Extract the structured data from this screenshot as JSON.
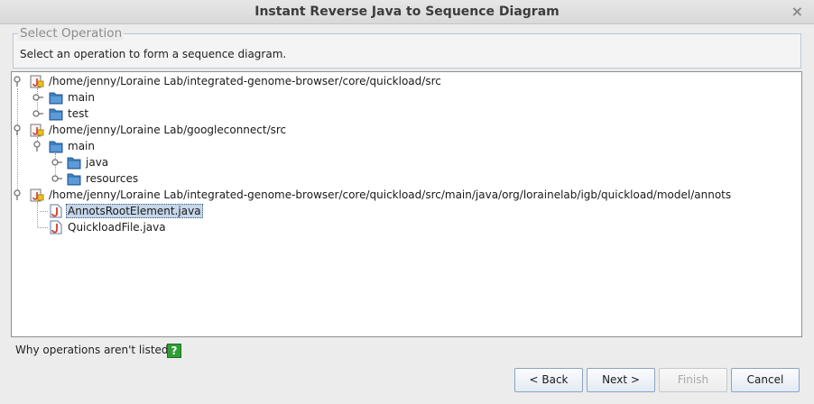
{
  "window": {
    "title": "Instant Reverse Java to Sequence Diagram",
    "close_glyph": "×"
  },
  "section": {
    "legend": "Select Operation",
    "description": "Select an operation to form a sequence diagram."
  },
  "tree": {
    "nodes": [
      {
        "label": "/home/jenny/Loraine Lab/integrated-genome-browser/core/quickload/src",
        "icon": "java-package-root-icon"
      },
      {
        "label": "main",
        "icon": "folder-icon"
      },
      {
        "label": "test",
        "icon": "folder-icon"
      },
      {
        "label": "/home/jenny/Loraine Lab/googleconnect/src",
        "icon": "java-package-root-icon"
      },
      {
        "label": "main",
        "icon": "folder-icon"
      },
      {
        "label": "java",
        "icon": "folder-icon"
      },
      {
        "label": "resources",
        "icon": "folder-icon"
      },
      {
        "label": "/home/jenny/Loraine Lab/integrated-genome-browser/core/quickload/src/main/java/org/lorainelab/igb/quickload/model/annots",
        "icon": "java-package-root-icon"
      },
      {
        "label": "AnnotsRootElement.java",
        "icon": "java-file-icon",
        "selected": true
      },
      {
        "label": "QuickloadFile.java",
        "icon": "java-file-icon"
      }
    ]
  },
  "help": {
    "text": "Why operations aren't listed?",
    "icon_glyph": "?"
  },
  "buttons": {
    "back": "< Back",
    "next": "Next >",
    "finish": "Finish",
    "cancel": "Cancel"
  },
  "colors": {
    "selection": "#c6d7ea",
    "folder": "#3d7fc1",
    "help_icon": "#2f9e34",
    "java_accent": "#d43a2a"
  }
}
